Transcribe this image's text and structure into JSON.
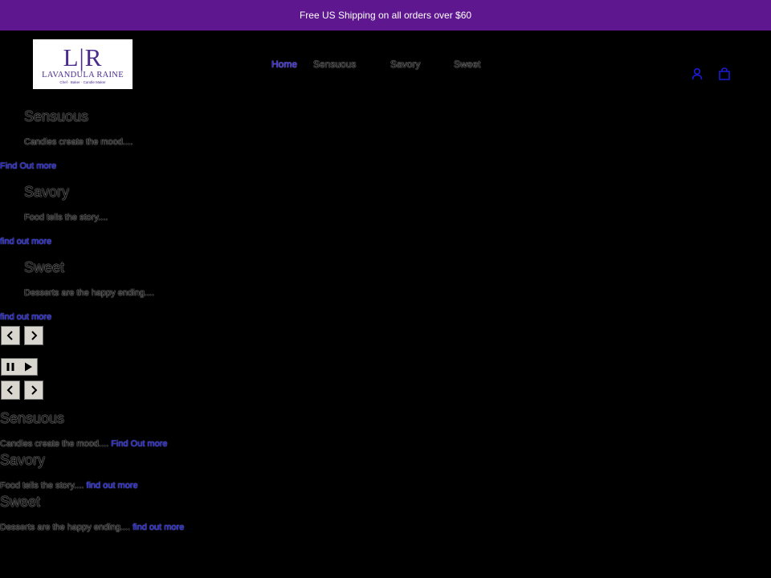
{
  "announcement": {
    "text": "Free US Shipping on all orders over $60"
  },
  "logo": {
    "monogram": "L|R",
    "name": "LAVANDULA RAINE",
    "tagline": "Chef · Baker · Candle Maker"
  },
  "nav": {
    "home": "Home",
    "sensuous": "Sensuous",
    "savory": "Savory",
    "sweet": "Sweet"
  },
  "header_icons": {
    "account": "account-icon",
    "cart": "cart-icon"
  },
  "slides": [
    {
      "title": "Sensuous",
      "text": "Candles create the mood....",
      "link": "Find Out more"
    },
    {
      "title": "Savory",
      "text": "Food tells the story....",
      "link": "find out more"
    },
    {
      "title": "Sweet",
      "text": "Desserts are the happy ending....",
      "link": "find out more"
    }
  ],
  "controls": {
    "prev_icon": "chevron-left-icon",
    "next_icon": "chevron-right-icon",
    "pause_icon": "pause-icon",
    "play_icon": "play-icon"
  },
  "colors": {
    "announcement_bg": "#5f1790",
    "link": "#2525c8",
    "logo": "#4a2a8c"
  }
}
